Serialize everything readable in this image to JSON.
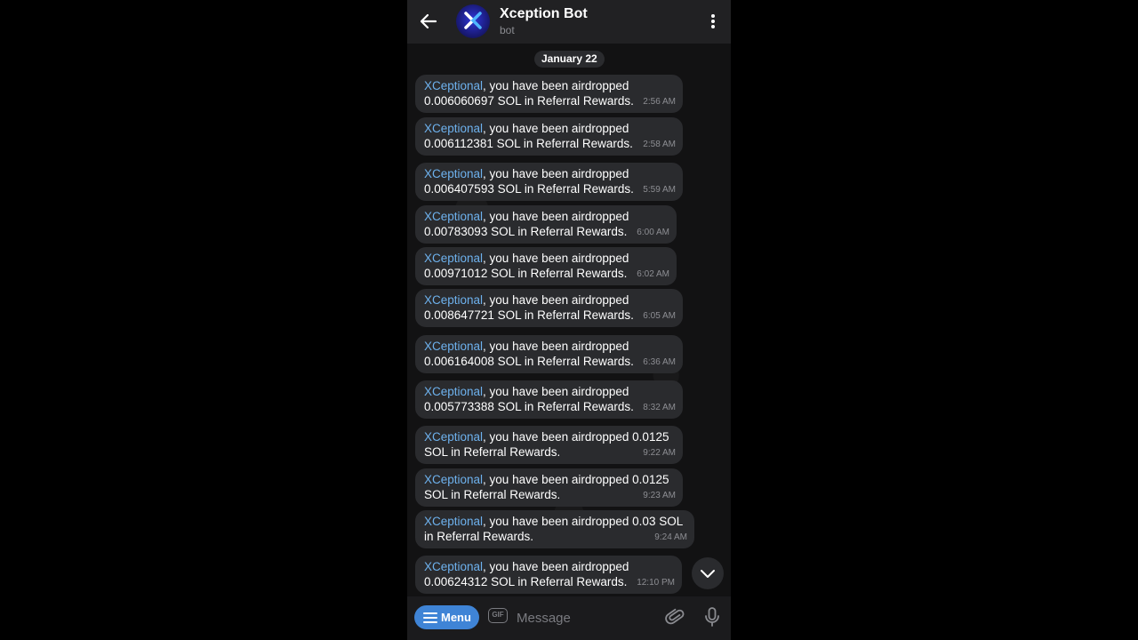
{
  "header": {
    "title": "Xception Bot",
    "subtitle": "bot"
  },
  "date_label": "January 22",
  "messages": [
    {
      "user": "XCeptional",
      "text": ", you have been airdropped\n0.006060697 SOL in Referral Rewards.",
      "time": "2:56 AM"
    },
    {
      "user": "XCeptional",
      "text": ", you have been airdropped\n0.006112381 SOL in Referral Rewards.",
      "time": "2:58 AM"
    },
    {
      "user": "XCeptional",
      "text": ", you have been airdropped\n0.006407593 SOL in Referral Rewards.",
      "time": "5:59 AM"
    },
    {
      "user": "XCeptional",
      "text": ", you have been airdropped\n0.00783093 SOL in Referral Rewards.",
      "time": "6:00 AM"
    },
    {
      "user": "XCeptional",
      "text": ", you have been airdropped\n0.00971012 SOL in Referral Rewards.",
      "time": "6:02 AM"
    },
    {
      "user": "XCeptional",
      "text": ", you have been airdropped\n0.008647721 SOL in Referral Rewards.",
      "time": "6:05 AM"
    },
    {
      "user": "XCeptional",
      "text": ", you have been airdropped\n0.006164008 SOL in Referral Rewards.",
      "time": "6:36 AM"
    },
    {
      "user": "XCeptional",
      "text": ", you have been airdropped\n0.005773388 SOL in Referral Rewards.",
      "time": "8:32 AM"
    },
    {
      "user": "XCeptional",
      "text": ", you have been airdropped 0.0125\nSOL in Referral Rewards.",
      "time": "9:22 AM"
    },
    {
      "user": "XCeptional",
      "text": ", you have been airdropped 0.0125\nSOL in Referral Rewards.",
      "time": "9:23 AM"
    },
    {
      "user": "XCeptional",
      "text": ", you have been airdropped 0.03 SOL\nin Referral Rewards.",
      "time": "9:24 AM"
    },
    {
      "user": "XCeptional",
      "text": ", you have been airdropped\n0.00624312 SOL in Referral Rewards.",
      "time": "12:10 PM"
    }
  ],
  "input": {
    "menu_label": "Menu",
    "gif_label": "GIF",
    "placeholder": "Message"
  },
  "colors": {
    "accent": "#3f84d6",
    "username": "#6eb2ee",
    "bubble": "#2a2b2e",
    "header": "#212123"
  }
}
